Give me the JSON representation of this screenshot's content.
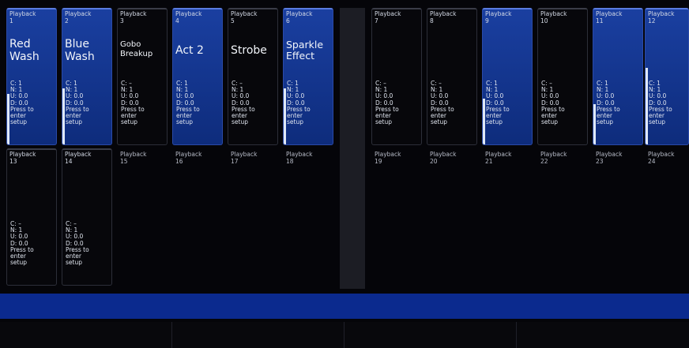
{
  "playbacks_left": [
    {
      "header": "Playback\n1",
      "name": "Red\nWash",
      "stats": "C: 1\nN: 1\nU: 0.0\nD: 0.0",
      "prompt": "Press to\nenter\nsetup",
      "state": "active"
    },
    {
      "header": "Playback\n2",
      "name": "Blue\nWash",
      "stats": "C: 1\nN: 1\nU: 0.0\nD: 0.0",
      "prompt": "Press to\nenter\nsetup",
      "state": "active"
    },
    {
      "header": "Playback\n3",
      "name": "Gobo\nBreakup",
      "stats": "C: –\nN: 1\nU: 0.0\nD: 0.0",
      "prompt": "Press to\nenter\nsetup",
      "state": "empty"
    },
    {
      "header": "Playback\n4",
      "name": "Act 2",
      "stats": "C: 1\nN: 1\nU: 0.0\nD: 0.0",
      "prompt": "Press to\nenter\nsetup",
      "state": "active"
    },
    {
      "header": "Playback\n5",
      "name": "Strobe",
      "stats": "C: –\nN: 1\nU: 0.0\nD: 0.0",
      "prompt": "Press to\nenter\nsetup",
      "state": "empty"
    },
    {
      "header": "Playback\n6",
      "name": "Sparkle\nEffect",
      "stats": "C: 1\nN: 1\nU: 0.0\nD: 0.0",
      "prompt": "Press to\nenter\nsetup",
      "state": "active"
    },
    {
      "header": "Playback\n13",
      "name": "",
      "stats": "C: –\nN: 1\nU: 0.0\nD: 0.0",
      "prompt": "Press to\nenter\nsetup",
      "state": "empty"
    },
    {
      "header": "Playback\n14",
      "name": "",
      "stats": "C: –\nN: 1\nU: 0.0\nD: 0.0",
      "prompt": "Press to\nenter\nsetup",
      "state": "empty"
    },
    {
      "header": "Playback\n15",
      "state": "plain"
    },
    {
      "header": "Playback\n16",
      "state": "plain"
    },
    {
      "header": "Playback\n17",
      "state": "plain"
    },
    {
      "header": "Playback\n18",
      "state": "plain"
    }
  ],
  "playbacks_right": [
    {
      "header": "Playback\n7",
      "stats": "C: –\nN: 1\nU: 0.0\nD: 0.0",
      "prompt": "Press to\nenter\nsetup",
      "state": "empty"
    },
    {
      "header": "Playback\n8",
      "stats": "C: –\nN: 1\nU: 0.0\nD: 0.0",
      "prompt": "Press to\nenter\nsetup",
      "state": "empty"
    },
    {
      "header": "Playback\n9",
      "stats": "C: 1\nN: 1\nU: 0.0\nD: 0.0",
      "prompt": "Press to\nenter\nsetup",
      "state": "active"
    },
    {
      "header": "Playback\n10",
      "stats": "C: –\nN: 1\nU: 0.0\nD: 0.0",
      "prompt": "Press to\nenter\nsetup",
      "state": "empty"
    },
    {
      "header": "Playback\n11",
      "stats": "C: 1\nN: 1\nU: 0.0\nD: 0.0",
      "prompt": "Press to\nenter\nsetup",
      "state": "active"
    },
    {
      "header": "Playback\n12",
      "stats": "C: 1\nN: 1\nU: 0.0\nD: 0.0",
      "prompt": "Press to\nenter\nsetup",
      "state": "active"
    },
    {
      "header": "Playback\n19",
      "state": "plain"
    },
    {
      "header": "Playback\n20",
      "state": "plain"
    },
    {
      "header": "Playback\n21",
      "state": "plain"
    },
    {
      "header": "Playback\n22",
      "state": "plain"
    },
    {
      "header": "Playback\n23",
      "state": "plain"
    },
    {
      "header": "Playback\n24",
      "state": "plain"
    }
  ],
  "fader_levels": {
    "playback_1": 0.5,
    "playback_2": 0.55,
    "playback_6": 0.55,
    "playback_9": 0.45,
    "playback_11": 0.4,
    "playback_12": 0.75
  },
  "colors": {
    "active": "#15379a",
    "stripe": "#0b2a8e",
    "background": "#050509"
  }
}
